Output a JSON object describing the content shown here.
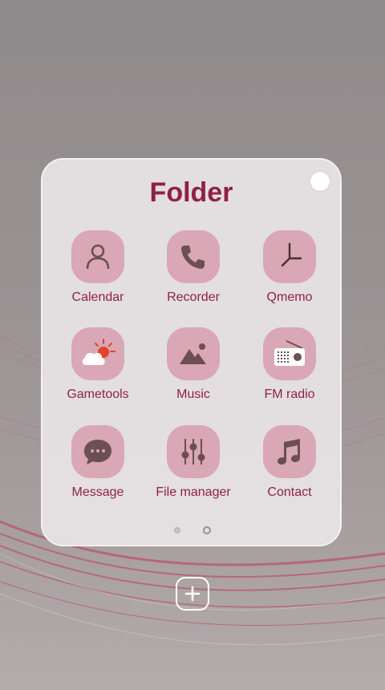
{
  "folder": {
    "title": "Folder",
    "apps": [
      {
        "label": "Calendar",
        "icon": "person-icon"
      },
      {
        "label": "Recorder",
        "icon": "phone-icon"
      },
      {
        "label": "Qmemo",
        "icon": "clock-icon"
      },
      {
        "label": "Gametools",
        "icon": "weather-icon"
      },
      {
        "label": "Music",
        "icon": "gallery-icon"
      },
      {
        "label": "FM radio",
        "icon": "radio-icon"
      },
      {
        "label": "Message",
        "icon": "chat-bubble-icon"
      },
      {
        "label": "File manager",
        "icon": "equalizer-icon"
      },
      {
        "label": "Contact",
        "icon": "music-note-icon"
      }
    ],
    "pages": {
      "count": 2,
      "current": 2
    }
  },
  "colors": {
    "accent": "#8e2148",
    "icon_bg": "#d9a7b5",
    "icon_glyph": "#6b4f52"
  },
  "add_button": {
    "icon": "plus-icon"
  }
}
